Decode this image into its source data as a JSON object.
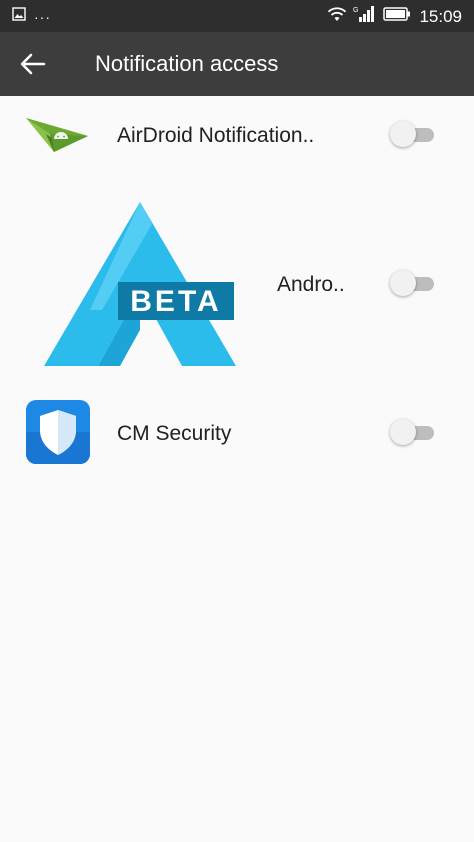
{
  "status_bar": {
    "time": "15:09",
    "more_indicator": "···",
    "icons": [
      "image-notification-icon",
      "wifi-icon",
      "signal-icon",
      "battery-icon"
    ],
    "network_type": "G"
  },
  "app_bar": {
    "title": "Notification access",
    "back_icon": "back-arrow-icon"
  },
  "apps": [
    {
      "label": "AirDroid Notification..",
      "icon": "airdroid-icon",
      "enabled": false
    },
    {
      "label": "Andro..",
      "icon": "android-beta-icon",
      "beta_text": "BETA",
      "enabled": false
    },
    {
      "label": "CM Security",
      "icon": "cm-security-shield-icon",
      "enabled": false
    }
  ],
  "colors": {
    "status_bar_bg": "#2e2e2e",
    "app_bar_bg": "#3d3d3d",
    "background": "#fafafa",
    "beta_blue": "#29b6e8",
    "airdroid_green": "#8bc34a",
    "cm_blue": "#1e88e5"
  }
}
